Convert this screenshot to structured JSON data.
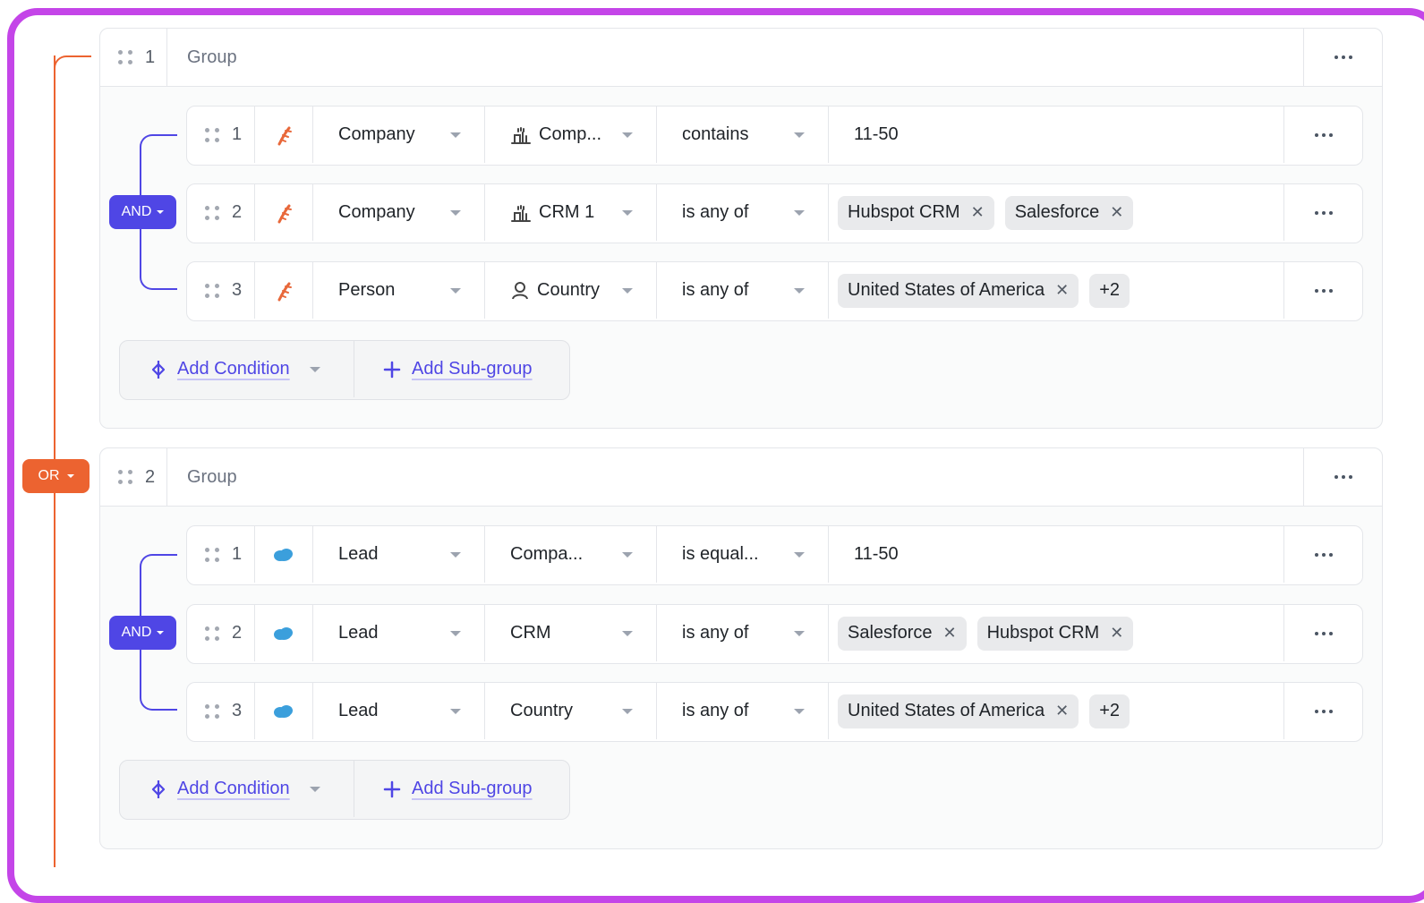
{
  "root_operator": "OR",
  "groups": [
    {
      "number": "1",
      "title": "Group",
      "operator": "AND",
      "conditions": [
        {
          "number": "1",
          "source": "hubspot",
          "object": "Company",
          "field": "Comp...",
          "field_icon": "company-icon",
          "operator": "contains",
          "value_text": "11-50",
          "chips": [],
          "more_count": ""
        },
        {
          "number": "2",
          "source": "hubspot",
          "object": "Company",
          "field": "CRM 1",
          "field_icon": "company-icon",
          "operator": "is any of",
          "value_text": "",
          "chips": [
            "Hubspot CRM",
            "Salesforce"
          ],
          "more_count": ""
        },
        {
          "number": "3",
          "source": "hubspot",
          "object": "Person",
          "field": "Country",
          "field_icon": "person-icon",
          "operator": "is any of",
          "value_text": "",
          "chips": [
            "United States of America"
          ],
          "more_count": "+2"
        }
      ],
      "add_condition_label": "Add Condition",
      "add_subgroup_label": "Add Sub-group"
    },
    {
      "number": "2",
      "title": "Group",
      "operator": "AND",
      "conditions": [
        {
          "number": "1",
          "source": "salesforce",
          "object": "Lead",
          "field": "Compa...",
          "field_icon": "",
          "operator": "is equal...",
          "value_text": "11-50",
          "chips": [],
          "more_count": ""
        },
        {
          "number": "2",
          "source": "salesforce",
          "object": "Lead",
          "field": "CRM",
          "field_icon": "",
          "operator": "is any of",
          "value_text": "",
          "chips": [
            "Salesforce",
            "Hubspot CRM"
          ],
          "more_count": ""
        },
        {
          "number": "3",
          "source": "salesforce",
          "object": "Lead",
          "field": "Country",
          "field_icon": "",
          "operator": "is any of",
          "value_text": "",
          "chips": [
            "United States of America"
          ],
          "more_count": "+2"
        }
      ],
      "add_condition_label": "Add Condition",
      "add_subgroup_label": "Add Sub-group"
    }
  ],
  "colors": {
    "frame": "#c445e8",
    "or": "#ec6330",
    "and": "#4f46e5",
    "hubspot": "#e8683a",
    "salesforce": "#3b9fdc"
  }
}
